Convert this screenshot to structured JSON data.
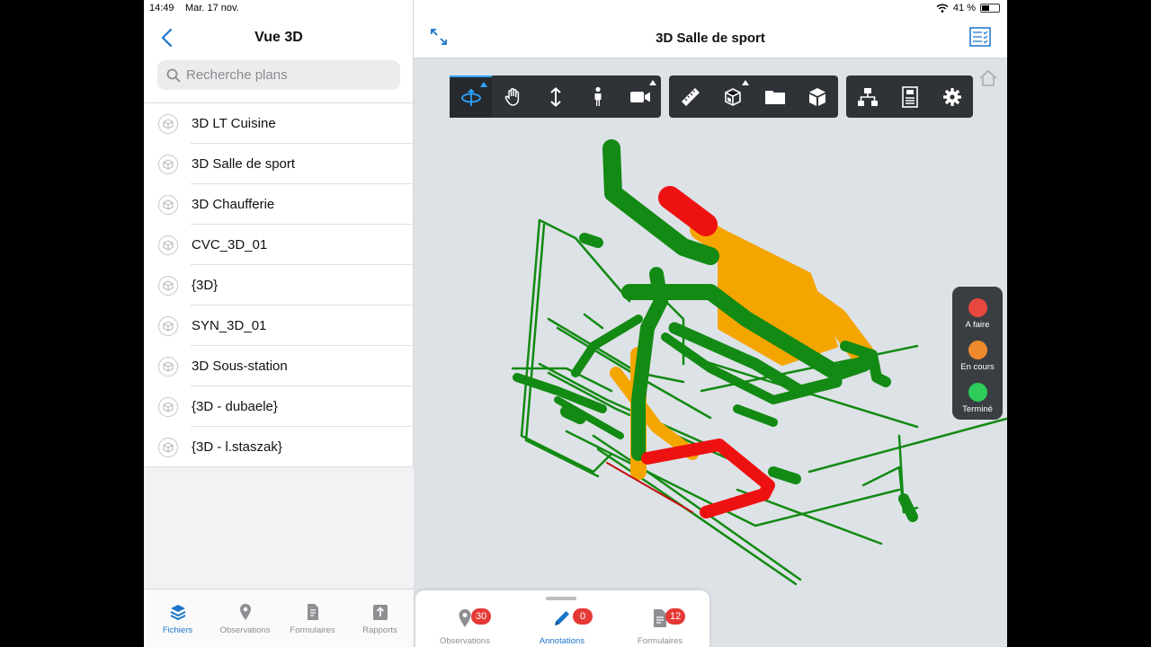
{
  "status": {
    "time": "14:49",
    "date": "Mar. 17 nov.",
    "battery": "41 %"
  },
  "left_panel": {
    "title": "Vue 3D",
    "search": {
      "placeholder": "Recherche plans",
      "value": ""
    },
    "plans": [
      {
        "label": "3D LT Cuisine"
      },
      {
        "label": "3D Salle de sport"
      },
      {
        "label": "3D Chaufferie"
      },
      {
        "label": "CVC_3D_01"
      },
      {
        "label": "{3D}"
      },
      {
        "label": "SYN_3D_01"
      },
      {
        "label": "3D Sous-station"
      },
      {
        "label": "{3D - dubaele}"
      },
      {
        "label": "{3D - l.staszak}"
      }
    ],
    "tabs": [
      {
        "label": "Fichiers",
        "icon": "layers-icon",
        "active": true
      },
      {
        "label": "Observations",
        "icon": "pin-icon",
        "active": false
      },
      {
        "label": "Formulaires",
        "icon": "document-icon",
        "active": false
      },
      {
        "label": "Rapports",
        "icon": "export-icon",
        "active": false
      }
    ]
  },
  "viewer": {
    "title": "3D Salle de sport",
    "legend": [
      {
        "label": "A faire",
        "color": "#e8473f"
      },
      {
        "label": "En cours",
        "color": "#ef8a2c"
      },
      {
        "label": "Terminé",
        "color": "#2ecc5a"
      }
    ],
    "bottom_tabs": [
      {
        "label": "Observations",
        "count": "30",
        "icon": "pin-icon"
      },
      {
        "label": "Annotations",
        "count": "0",
        "icon": "pencil-icon",
        "active": true
      },
      {
        "label": "Formulaires",
        "count": "12",
        "icon": "document-icon"
      }
    ]
  },
  "colors": {
    "accent": "#1a74c9",
    "model_done": "#138a13",
    "model_in_progress": "#f5a500",
    "model_todo": "#ee1111"
  }
}
